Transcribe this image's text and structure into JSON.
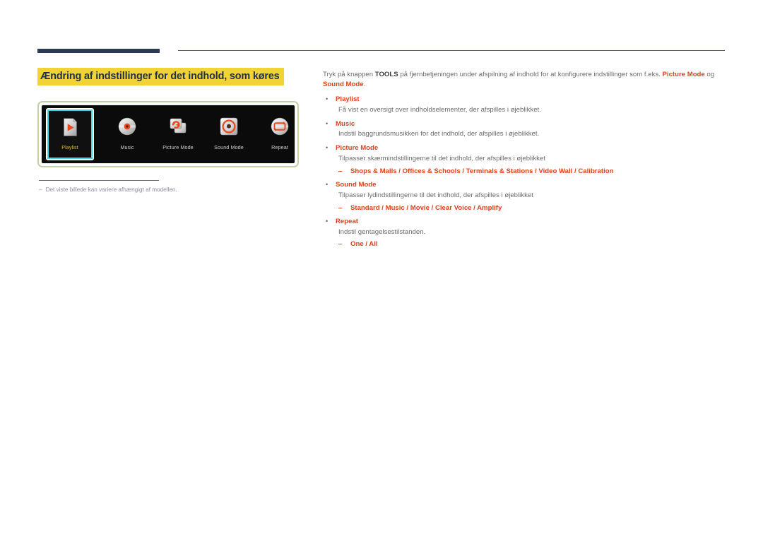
{
  "page": {
    "title": "Ændring af indstillinger for det indhold, som køres",
    "highlight_color": "#f2d335",
    "title_color": "#22304a",
    "accent_color": "#e0401b",
    "rule_color": "#2b3a55"
  },
  "figure": {
    "frame_border_color": "#c2d0a6",
    "panel_bg": "#0b0b0b",
    "selected_border_color": "#3fd6e0",
    "selected_label_color": "#e0b83a",
    "tiles": [
      {
        "label": "Playlist",
        "icon": "playlist-document-play-icon",
        "selected": true
      },
      {
        "label": "Music",
        "icon": "music-disc-icon",
        "selected": false
      },
      {
        "label": "Picture Mode",
        "icon": "picture-mode-screens-refresh-icon",
        "selected": false
      },
      {
        "label": "Sound Mode",
        "icon": "sound-mode-speaker-icon",
        "selected": false
      },
      {
        "label": "Repeat",
        "icon": "repeat-loop-icon",
        "selected": false
      }
    ]
  },
  "footnote": {
    "dash": "‒",
    "text": "Det viste billede kan variere afhængigt af modellen."
  },
  "content": {
    "intro": {
      "part1": "Tryk på knappen ",
      "tools": "TOOLS",
      "part2": " på fjernbetjeningen under afspilning af indhold for at konfigurere indstillinger som f.eks. ",
      "kw1": "Picture Mode",
      "part3": " og ",
      "kw2": "Sound Mode",
      "part4": "."
    },
    "bullet_glyph": "•",
    "dash_glyph": "‒",
    "items": [
      {
        "title": "Playlist",
        "desc": "Få vist en oversigt over indholdselementer, der afspilles i øjeblikket.",
        "options": ""
      },
      {
        "title": "Music",
        "desc": "Indstil baggrundsmusikken for det indhold, der afspilles i øjeblikket.",
        "options": ""
      },
      {
        "title": "Picture Mode",
        "desc": "Tilpasser skærmindstillingerne til det indhold, der afspilles i øjeblikket",
        "options": "Shops & Malls / Offices & Schools / Terminals & Stations / Video Wall / Calibration"
      },
      {
        "title": "Sound Mode",
        "desc": "Tilpasser lydindstillingerne til det indhold, der afspilles i øjeblikket",
        "options": "Standard / Music / Movie / Clear Voice / Amplify"
      },
      {
        "title": "Repeat",
        "desc": "Indstil gentagelsestilstanden.",
        "options": "One / All"
      }
    ]
  }
}
